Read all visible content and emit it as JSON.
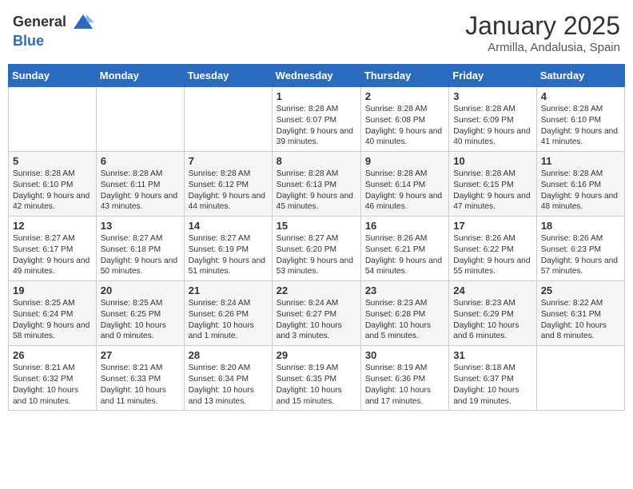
{
  "header": {
    "logo_line1": "General",
    "logo_line2": "Blue",
    "month": "January 2025",
    "location": "Armilla, Andalusia, Spain"
  },
  "days_of_week": [
    "Sunday",
    "Monday",
    "Tuesday",
    "Wednesday",
    "Thursday",
    "Friday",
    "Saturday"
  ],
  "weeks": [
    [
      {
        "day": "",
        "info": ""
      },
      {
        "day": "",
        "info": ""
      },
      {
        "day": "",
        "info": ""
      },
      {
        "day": "1",
        "info": "Sunrise: 8:28 AM\nSunset: 6:07 PM\nDaylight: 9 hours and 39 minutes."
      },
      {
        "day": "2",
        "info": "Sunrise: 8:28 AM\nSunset: 6:08 PM\nDaylight: 9 hours and 40 minutes."
      },
      {
        "day": "3",
        "info": "Sunrise: 8:28 AM\nSunset: 6:09 PM\nDaylight: 9 hours and 40 minutes."
      },
      {
        "day": "4",
        "info": "Sunrise: 8:28 AM\nSunset: 6:10 PM\nDaylight: 9 hours and 41 minutes."
      }
    ],
    [
      {
        "day": "5",
        "info": "Sunrise: 8:28 AM\nSunset: 6:10 PM\nDaylight: 9 hours and 42 minutes."
      },
      {
        "day": "6",
        "info": "Sunrise: 8:28 AM\nSunset: 6:11 PM\nDaylight: 9 hours and 43 minutes."
      },
      {
        "day": "7",
        "info": "Sunrise: 8:28 AM\nSunset: 6:12 PM\nDaylight: 9 hours and 44 minutes."
      },
      {
        "day": "8",
        "info": "Sunrise: 8:28 AM\nSunset: 6:13 PM\nDaylight: 9 hours and 45 minutes."
      },
      {
        "day": "9",
        "info": "Sunrise: 8:28 AM\nSunset: 6:14 PM\nDaylight: 9 hours and 46 minutes."
      },
      {
        "day": "10",
        "info": "Sunrise: 8:28 AM\nSunset: 6:15 PM\nDaylight: 9 hours and 47 minutes."
      },
      {
        "day": "11",
        "info": "Sunrise: 8:28 AM\nSunset: 6:16 PM\nDaylight: 9 hours and 48 minutes."
      }
    ],
    [
      {
        "day": "12",
        "info": "Sunrise: 8:27 AM\nSunset: 6:17 PM\nDaylight: 9 hours and 49 minutes."
      },
      {
        "day": "13",
        "info": "Sunrise: 8:27 AM\nSunset: 6:18 PM\nDaylight: 9 hours and 50 minutes."
      },
      {
        "day": "14",
        "info": "Sunrise: 8:27 AM\nSunset: 6:19 PM\nDaylight: 9 hours and 51 minutes."
      },
      {
        "day": "15",
        "info": "Sunrise: 8:27 AM\nSunset: 6:20 PM\nDaylight: 9 hours and 53 minutes."
      },
      {
        "day": "16",
        "info": "Sunrise: 8:26 AM\nSunset: 6:21 PM\nDaylight: 9 hours and 54 minutes."
      },
      {
        "day": "17",
        "info": "Sunrise: 8:26 AM\nSunset: 6:22 PM\nDaylight: 9 hours and 55 minutes."
      },
      {
        "day": "18",
        "info": "Sunrise: 8:26 AM\nSunset: 6:23 PM\nDaylight: 9 hours and 57 minutes."
      }
    ],
    [
      {
        "day": "19",
        "info": "Sunrise: 8:25 AM\nSunset: 6:24 PM\nDaylight: 9 hours and 58 minutes."
      },
      {
        "day": "20",
        "info": "Sunrise: 8:25 AM\nSunset: 6:25 PM\nDaylight: 10 hours and 0 minutes."
      },
      {
        "day": "21",
        "info": "Sunrise: 8:24 AM\nSunset: 6:26 PM\nDaylight: 10 hours and 1 minute."
      },
      {
        "day": "22",
        "info": "Sunrise: 8:24 AM\nSunset: 6:27 PM\nDaylight: 10 hours and 3 minutes."
      },
      {
        "day": "23",
        "info": "Sunrise: 8:23 AM\nSunset: 6:28 PM\nDaylight: 10 hours and 5 minutes."
      },
      {
        "day": "24",
        "info": "Sunrise: 8:23 AM\nSunset: 6:29 PM\nDaylight: 10 hours and 6 minutes."
      },
      {
        "day": "25",
        "info": "Sunrise: 8:22 AM\nSunset: 6:31 PM\nDaylight: 10 hours and 8 minutes."
      }
    ],
    [
      {
        "day": "26",
        "info": "Sunrise: 8:21 AM\nSunset: 6:32 PM\nDaylight: 10 hours and 10 minutes."
      },
      {
        "day": "27",
        "info": "Sunrise: 8:21 AM\nSunset: 6:33 PM\nDaylight: 10 hours and 11 minutes."
      },
      {
        "day": "28",
        "info": "Sunrise: 8:20 AM\nSunset: 6:34 PM\nDaylight: 10 hours and 13 minutes."
      },
      {
        "day": "29",
        "info": "Sunrise: 8:19 AM\nSunset: 6:35 PM\nDaylight: 10 hours and 15 minutes."
      },
      {
        "day": "30",
        "info": "Sunrise: 8:19 AM\nSunset: 6:36 PM\nDaylight: 10 hours and 17 minutes."
      },
      {
        "day": "31",
        "info": "Sunrise: 8:18 AM\nSunset: 6:37 PM\nDaylight: 10 hours and 19 minutes."
      },
      {
        "day": "",
        "info": ""
      }
    ]
  ]
}
